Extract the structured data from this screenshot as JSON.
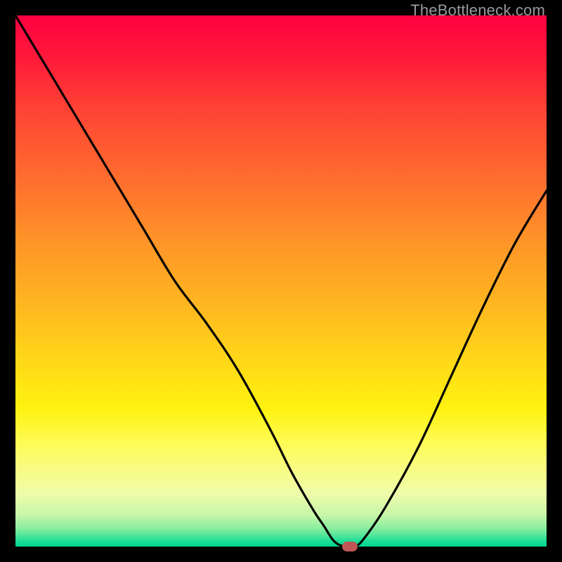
{
  "watermark": "TheBottleneck.com",
  "colors": {
    "curve": "#000000",
    "marker": "#c05555",
    "frame": "#000000"
  },
  "chart_data": {
    "type": "line",
    "title": "",
    "xlabel": "",
    "ylabel": "",
    "xlim": [
      0,
      100
    ],
    "ylim": [
      0,
      100
    ],
    "grid": false,
    "legend": false,
    "background_gradient": "red→orange→yellow→green (vertical, top=100%, bottom=0%)",
    "series": [
      {
        "name": "bottleneck-curve",
        "x": [
          0,
          6,
          12,
          18,
          24,
          30,
          36,
          42,
          48,
          52,
          56,
          58,
          60,
          62,
          64,
          66,
          70,
          76,
          82,
          88,
          94,
          100
        ],
        "y": [
          100,
          90,
          80,
          70,
          60,
          50,
          42,
          33,
          22,
          14,
          7,
          4,
          1,
          0,
          0,
          2,
          8,
          19,
          32,
          45,
          57,
          67
        ]
      }
    ],
    "marker": {
      "x": 63,
      "y": 0,
      "shape": "rounded-rect",
      "color": "#c05555"
    },
    "notes": "V-shaped curve; minimum (optimal match) around x≈63 where y≈0. Left branch descends from top-left corner; right branch rises to about y≈67 at x=100."
  }
}
